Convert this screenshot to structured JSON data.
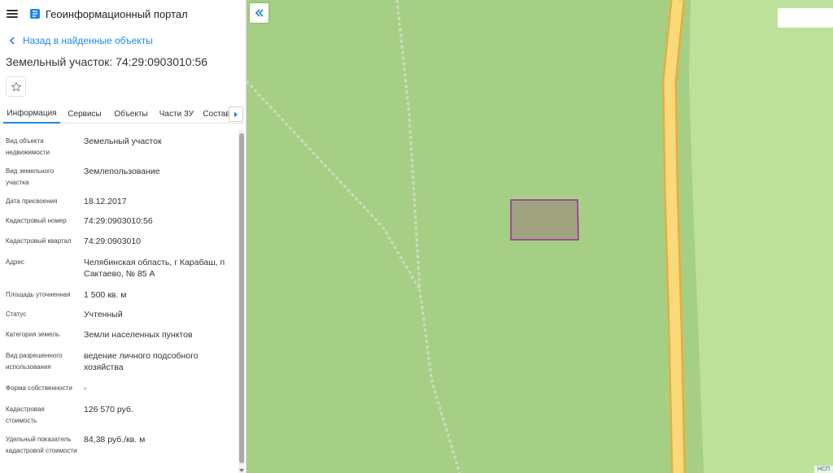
{
  "app": {
    "title": "Геоинформационный портал"
  },
  "nav": {
    "back_label": "Назад в найденные объекты"
  },
  "object": {
    "title": "Земельный участок: 74:29:0903010:56"
  },
  "tabs": [
    {
      "label": "Информация",
      "active": true
    },
    {
      "label": "Сервисы",
      "active": false
    },
    {
      "label": "Объекты",
      "active": false
    },
    {
      "label": "Части ЗУ",
      "active": false
    },
    {
      "label": "Состав",
      "active": false
    }
  ],
  "info": [
    {
      "label": "Вид объекта недвижимости",
      "value": "Земельный участок"
    },
    {
      "label": "Вид земельного участка",
      "value": "Землепользование"
    },
    {
      "label": "Дата присвоения",
      "value": "18.12.2017"
    },
    {
      "label": "Кадастровый номер",
      "value": "74:29:0903010:56"
    },
    {
      "label": "Кадастровый квартал",
      "value": "74:29:0903010"
    },
    {
      "label": "Адрес",
      "value": "Челябинская область, г Карабаш, п Сактаево, № 85 А"
    },
    {
      "label": "Площадь уточненная",
      "value": "1 500 кв. м"
    },
    {
      "label": "Статус",
      "value": "Учтенный"
    },
    {
      "label": "Категория земель",
      "value": "Земли населенных пунктов"
    },
    {
      "label": "Вид разрешенного использования",
      "value": "ведение личного подсобного хозяйства"
    },
    {
      "label": "Форма собственности",
      "value": "-"
    },
    {
      "label": "Кадастровая стоимость",
      "value": "126 570 руб."
    },
    {
      "label": "Удельный показатель кадастровой стоимости",
      "value": "84,38 руб./кв. м"
    }
  ],
  "map": {
    "attribution": "НСП",
    "colors": {
      "field": "#a6cf86",
      "light_field": "#bde19b",
      "road_fill": "#f9d97a",
      "road_edge": "#e9ad3a",
      "parcel_fill": "#a0a280",
      "parcel_stroke": "#9b2a9b",
      "path": "#c9ddb9"
    }
  },
  "icons": {
    "menu": "hamburger-icon",
    "logo": "portal-logo-icon",
    "back": "chevron-left-icon",
    "star": "star-outline-icon",
    "tabs_next": "chevron-right-icon",
    "collapse": "double-chevron-left-icon"
  }
}
